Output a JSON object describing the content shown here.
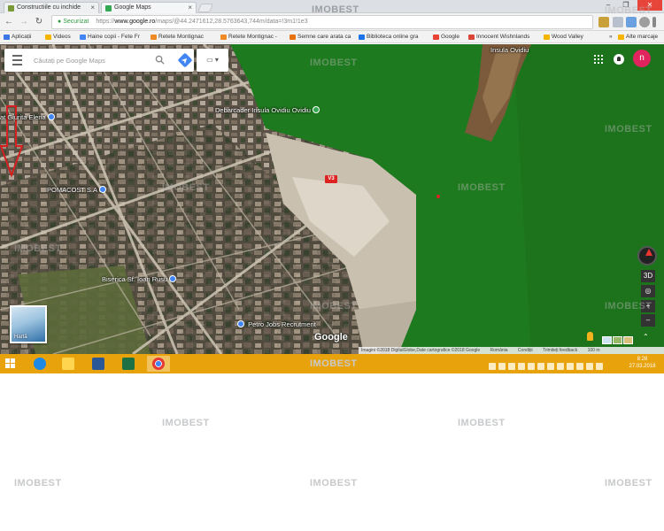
{
  "browser": {
    "tabs": [
      {
        "label": "Constructiile cu inchide",
        "favicon_color": "#7a9a3a"
      },
      {
        "label": "Google Maps",
        "favicon_color": "#34a853"
      }
    ],
    "tab_close": "×",
    "window_controls": {
      "minimize": "–",
      "maximize": "❐",
      "close": "✕"
    },
    "nav": {
      "back": "←",
      "forward": "→",
      "reload": "↻"
    },
    "address": {
      "secure_label": "Securizat",
      "url_scheme": "https://",
      "url_host": "www.google.ro",
      "url_path": "/maps/@44.2471612,28.5763643,744m/data=!3m1!1e3"
    },
    "bookmarks": [
      {
        "label": "Aplicații",
        "color": "#3b78e7"
      },
      {
        "label": "Videos",
        "color": "#f4b400"
      },
      {
        "label": "Haine copii - Fete Fr",
        "color": "#4285f4"
      },
      {
        "label": "Retete Montignac",
        "color": "#f08a24"
      },
      {
        "label": "Retete Montignac - ",
        "color": "#f08a24"
      },
      {
        "label": "Semne care arata ca",
        "color": "#e8710a"
      },
      {
        "label": "Biblioteca online gra",
        "color": "#1a73e8"
      },
      {
        "label": "Google",
        "color": "#ea4335"
      },
      {
        "label": "Innocent Wishnlands",
        "color": "#db4437"
      },
      {
        "label": "Wood Valley",
        "color": "#f4b400"
      }
    ],
    "bookmarks_overflow": "»",
    "bookmarks_other": "Alte marcaje"
  },
  "watermark": "IMOBEST",
  "map": {
    "search": {
      "placeholder": "Căutați pe Google Maps"
    },
    "layer_toggle": "▭ ▾",
    "avatar_initial": "n",
    "marker_label": "V3",
    "pois": [
      {
        "label": "Debarcader Insula Ovidiu Ovidiu",
        "color": "#34a853"
      },
      {
        "label": "Insula Ovidiu",
        "color": ""
      },
      {
        "label": "at Giurita Elena",
        "color": "#4285f4"
      },
      {
        "label": "POMACOST S.A",
        "color": "#4285f4"
      },
      {
        "label": "Biserica Sf. Ioan Rusu",
        "color": "#4285f4"
      },
      {
        "label": "Petro Jobs Recrutment",
        "color": "#4285f4"
      }
    ],
    "google_logo": "Google",
    "thumbnail_label": "Hartă",
    "controls": {
      "tilt": "3D",
      "locate": "◎",
      "zoom_in": "+",
      "zoom_out": "–",
      "expand": "⌃"
    },
    "attribution": [
      "Imagini ©2018 DigitalGlobe,Date cartografice ©2018 Google",
      "România",
      "Condiții",
      "Trimiteți feedback",
      "100 m"
    ]
  },
  "taskbar": {
    "clock_time": "8:28",
    "clock_date": "27.03.2018",
    "pinned": [
      {
        "name": "internet-explorer",
        "color": "#1e88e5"
      },
      {
        "name": "file-explorer",
        "color": "#ffd54f"
      },
      {
        "name": "word",
        "color": "#2b5797"
      },
      {
        "name": "excel",
        "color": "#1e7145"
      },
      {
        "name": "chrome",
        "color": "#e53935"
      }
    ]
  }
}
